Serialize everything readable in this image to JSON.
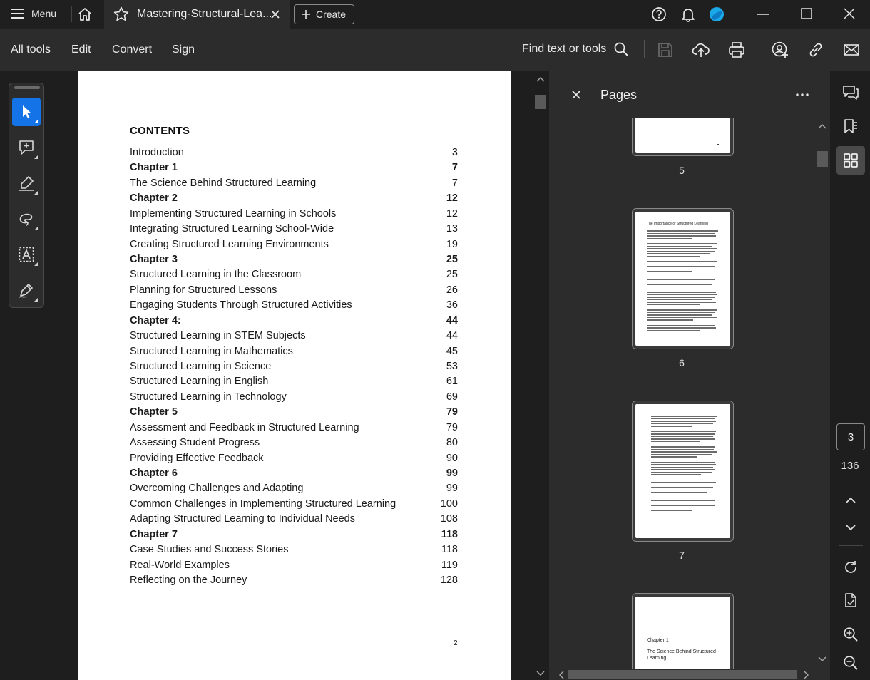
{
  "titlebar": {
    "menu_label": "Menu",
    "tab_title": "Mastering-Structural-Lea...",
    "create_label": "Create"
  },
  "toolbar": {
    "all_tools": "All tools",
    "edit": "Edit",
    "convert": "Convert",
    "sign": "Sign",
    "find": "Find text or tools"
  },
  "document": {
    "contents_title": "CONTENTS",
    "toc": [
      {
        "title": "Introduction",
        "page": "3",
        "bold": false
      },
      {
        "title": "Chapter 1",
        "page": "7",
        "bold": true
      },
      {
        "title": "The Science Behind Structured Learning",
        "page": "7",
        "bold": false
      },
      {
        "title": "Chapter 2",
        "page": "12",
        "bold": true
      },
      {
        "title": "Implementing Structured Learning in Schools",
        "page": "12",
        "bold": false
      },
      {
        "title": "Integrating Structured Learning School-Wide",
        "page": "13",
        "bold": false
      },
      {
        "title": "Creating Structured Learning Environments",
        "page": "19",
        "bold": false
      },
      {
        "title": "Chapter 3",
        "page": "25",
        "bold": true
      },
      {
        "title": "Structured Learning in the Classroom",
        "page": "25",
        "bold": false
      },
      {
        "title": "Planning for Structured Lessons",
        "page": "26",
        "bold": false
      },
      {
        "title": "Engaging Students Through Structured Activities",
        "page": "36",
        "bold": false
      },
      {
        "title": "Chapter 4:",
        "page": "44",
        "bold": true
      },
      {
        "title": "Structured Learning in STEM Subjects",
        "page": "44",
        "bold": false
      },
      {
        "title": "Structured Learning in Mathematics",
        "page": "45",
        "bold": false
      },
      {
        "title": "Structured Learning in Science",
        "page": "53",
        "bold": false
      },
      {
        "title": "Structured Learning in English",
        "page": "61",
        "bold": false
      },
      {
        "title": "Structured Learning in Technology",
        "page": "69",
        "bold": false
      },
      {
        "title": "Chapter 5",
        "page": "79",
        "bold": true
      },
      {
        "title": "Assessment and Feedback in Structured Learning",
        "page": "79",
        "bold": false
      },
      {
        "title": "Assessing Student Progress",
        "page": "80",
        "bold": false
      },
      {
        "title": "Providing Effective Feedback",
        "page": "90",
        "bold": false
      },
      {
        "title": "Chapter 6",
        "page": "99",
        "bold": true
      },
      {
        "title": "Overcoming Challenges and Adapting",
        "page": "99",
        "bold": false
      },
      {
        "title": "Common Challenges in Implementing Structured Learning",
        "page": "100",
        "bold": false
      },
      {
        "title": "Adapting Structured Learning to Individual Needs",
        "page": "108",
        "bold": false
      },
      {
        "title": "Chapter 7",
        "page": "118",
        "bold": true
      },
      {
        "title": "Case Studies and Success Stories",
        "page": "118",
        "bold": false
      },
      {
        "title": "Real-World Examples",
        "page": "119",
        "bold": false
      },
      {
        "title": "Reflecting on the Journey",
        "page": "128",
        "bold": false
      }
    ],
    "page_number": "2"
  },
  "pages_pane": {
    "title": "Pages",
    "thumbnails": [
      {
        "label": "5"
      },
      {
        "label": "6",
        "heading": "The Importance of Structured Learning"
      },
      {
        "label": "7"
      },
      {
        "label": "",
        "line1": "Chapter 1",
        "line2": "The Science Behind Structured Learning"
      }
    ]
  },
  "navigation": {
    "current_page": "3",
    "total_pages": "136"
  },
  "colors": {
    "accent": "#1473e6",
    "background": "#1e1e1e",
    "panel": "#2c2c2c"
  }
}
